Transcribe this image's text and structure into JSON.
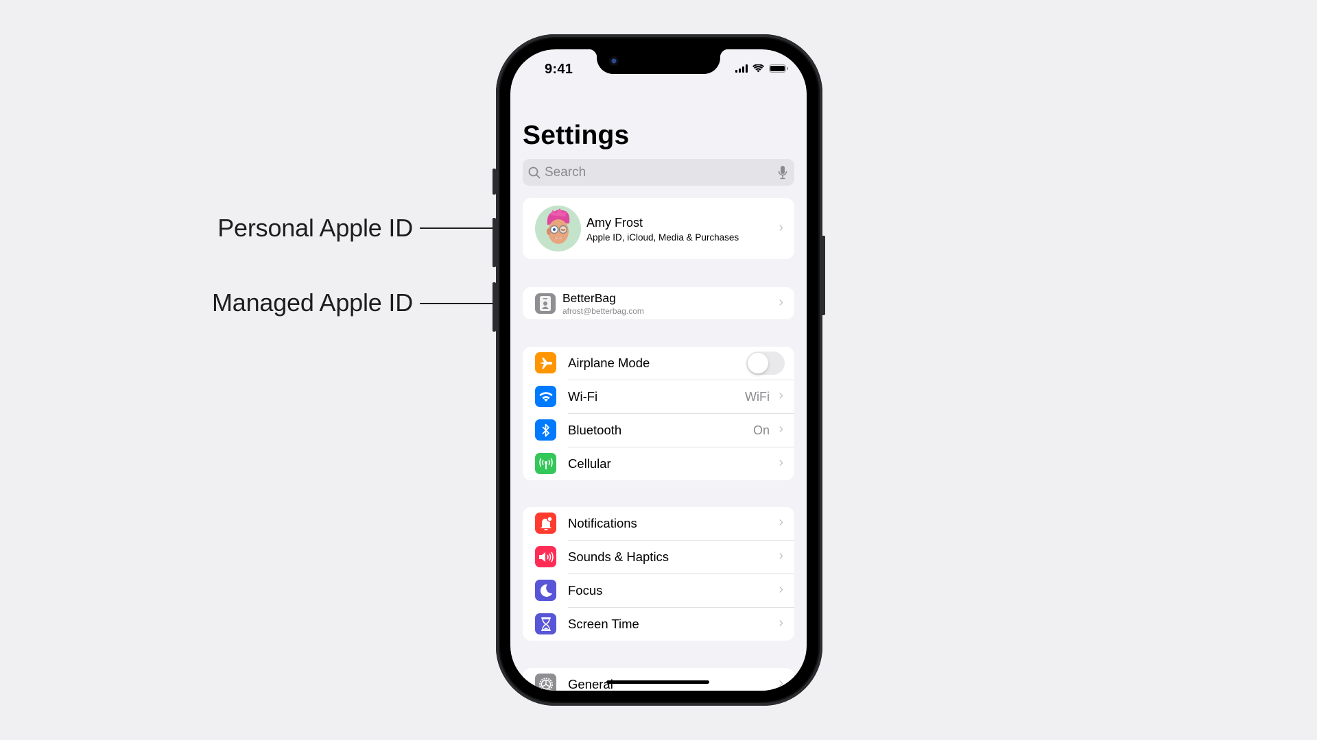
{
  "callouts": [
    {
      "label": "Personal Apple ID"
    },
    {
      "label": "Managed Apple ID"
    }
  ],
  "status_bar": {
    "time": "9:41",
    "icons": [
      "cellular-signal-icon",
      "wifi-icon",
      "battery-icon"
    ]
  },
  "settings": {
    "title": "Settings",
    "search": {
      "placeholder": "Search",
      "icon": "search-icon",
      "mic_icon": "microphone-icon"
    },
    "profile": {
      "name": "Amy Frost",
      "subtitle": "Apple ID, iCloud, Media & Purchases",
      "avatar": "memoji-avatar"
    },
    "managed": {
      "name": "BetterBag",
      "email": "afrost@betterbag.com",
      "icon": "id-badge-icon"
    },
    "connectivity": [
      {
        "label": "Airplane Mode",
        "icon": "airplane-icon",
        "color": "#ff9500",
        "toggle": false
      },
      {
        "label": "Wi-Fi",
        "icon": "wifi-icon",
        "color": "#007aff",
        "value": "WiFi"
      },
      {
        "label": "Bluetooth",
        "icon": "bluetooth-icon",
        "color": "#007aff",
        "value": "On"
      },
      {
        "label": "Cellular",
        "icon": "cellular-antenna-icon",
        "color": "#34c759",
        "value": ""
      }
    ],
    "notifications_group": [
      {
        "label": "Notifications",
        "icon": "bell-icon",
        "color": "#ff3b30"
      },
      {
        "label": "Sounds & Haptics",
        "icon": "speaker-icon",
        "color": "#ff2d55"
      },
      {
        "label": "Focus",
        "icon": "moon-icon",
        "color": "#5856d6"
      },
      {
        "label": "Screen Time",
        "icon": "hourglass-icon",
        "color": "#5856d6"
      }
    ],
    "general": {
      "label": "General",
      "icon": "gear-icon",
      "color": "#8e8e93"
    }
  }
}
